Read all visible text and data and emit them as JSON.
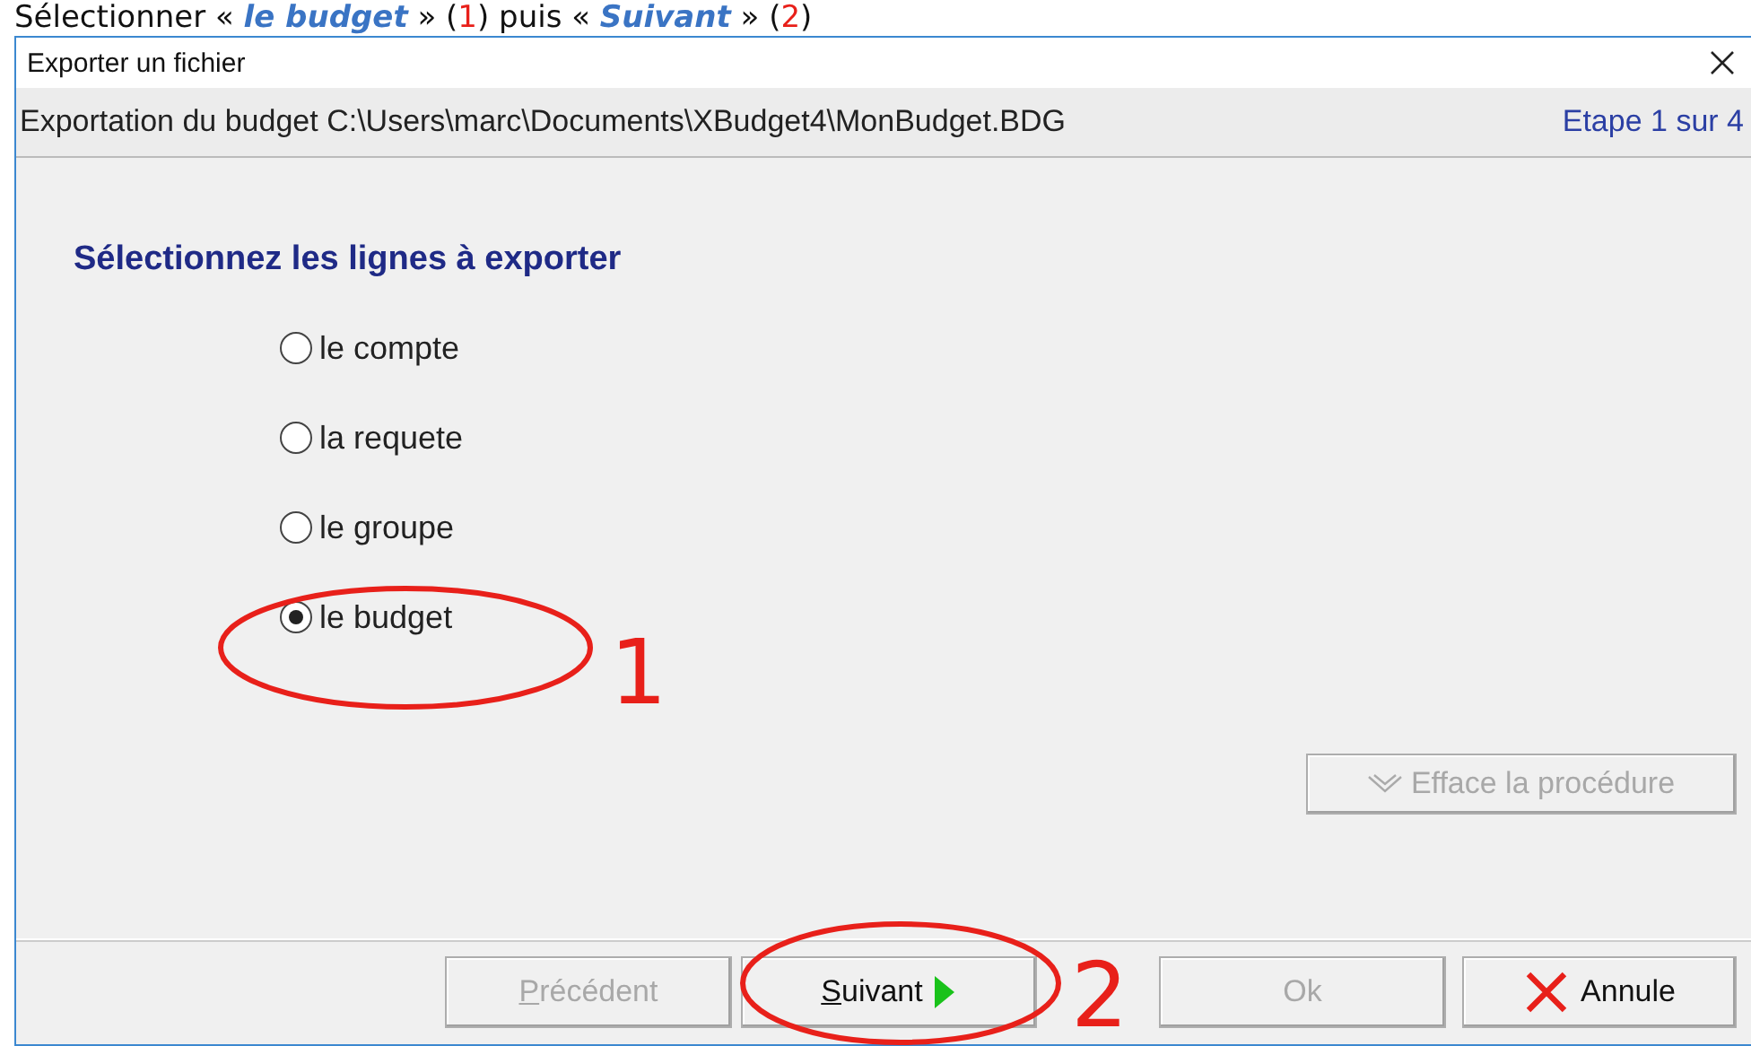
{
  "caption": [
    {
      "kind": "plain",
      "text": "Sélectionner « "
    },
    {
      "kind": "emph",
      "text": "le budget"
    },
    {
      "kind": "plain",
      "text": " » ("
    },
    {
      "kind": "num",
      "text": "1"
    },
    {
      "kind": "plain",
      "text": ") puis « "
    },
    {
      "kind": "emph",
      "text": "Suivant"
    },
    {
      "kind": "plain",
      "text": " » ("
    },
    {
      "kind": "num",
      "text": "2"
    },
    {
      "kind": "plain",
      "text": ")"
    }
  ],
  "window": {
    "title": "Exporter un fichier"
  },
  "header": {
    "path": "Exportation du budget C:\\Users\\marc\\Documents\\XBudget4\\MonBudget.BDG",
    "step": "Etape 1 sur 4"
  },
  "heading": "Sélectionnez les lignes à exporter",
  "options": [
    {
      "label": "le compte",
      "selected": false
    },
    {
      "label": "la requete",
      "selected": false
    },
    {
      "label": "le groupe",
      "selected": false
    },
    {
      "label": "le budget",
      "selected": true
    }
  ],
  "clear_button": {
    "label": "Efface la procédure",
    "disabled": true
  },
  "buttons": [
    {
      "kind": "previous",
      "label": "Précédent",
      "disabled": true
    },
    {
      "kind": "next",
      "label": "Suivant",
      "disabled": false
    },
    {
      "kind": "ok",
      "label": "Ok",
      "disabled": true
    },
    {
      "kind": "cancel",
      "label": "Annule",
      "disabled": false
    }
  ],
  "annotations": [
    {
      "label": "1"
    },
    {
      "label": "2"
    }
  ]
}
